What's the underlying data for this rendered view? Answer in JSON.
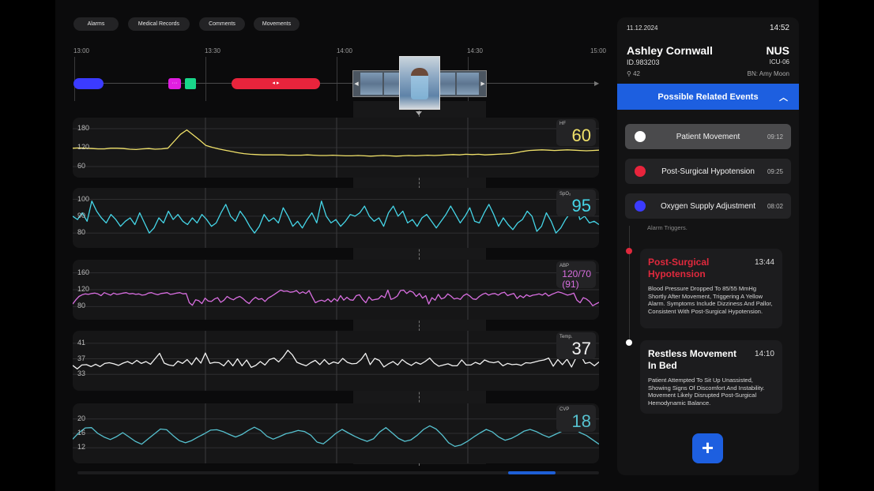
{
  "nav": {
    "tabs": [
      "Alarms",
      "Medical Records",
      "Comments",
      "Movements"
    ]
  },
  "timeline": {
    "ticks": [
      "13:00",
      "13:30",
      "14:00",
      "14:30",
      "15:00"
    ],
    "events": [
      {
        "color": "#3b3bff"
      },
      {
        "color": "#e01ee0",
        "glyph": "···"
      },
      {
        "color": "#19d68a"
      },
      {
        "color": "#e8243c",
        "glyph": "◂ ▸"
      }
    ]
  },
  "vitals": [
    {
      "name": "HF",
      "value": "60",
      "color": "#f1e26a",
      "ticks": [
        "180",
        "120",
        "60"
      ],
      "range": [
        40,
        200
      ],
      "data": [
        118,
        119,
        118,
        117,
        116,
        116,
        118,
        118,
        117,
        115,
        114,
        116,
        117,
        115,
        116,
        118,
        140,
        162,
        176,
        160,
        144,
        127,
        121,
        116,
        112,
        108,
        104,
        101,
        99,
        98,
        97,
        97,
        97,
        97,
        96,
        96,
        96,
        97,
        96,
        95,
        95,
        96,
        95,
        94,
        94,
        95,
        94,
        93,
        94,
        95,
        94,
        93,
        94,
        95,
        94,
        95,
        96,
        95,
        96,
        97,
        98,
        97,
        99,
        98,
        99,
        97,
        98,
        99,
        100,
        101,
        104,
        108,
        111,
        112,
        113,
        112,
        111,
        112,
        113,
        112,
        111,
        110,
        111,
        112
      ]
    },
    {
      "name": "SpO₂",
      "value": "95",
      "color": "#45d6e8",
      "ticks": [
        "100",
        "90",
        "80"
      ],
      "range": [
        74,
        104
      ],
      "data": [
        90,
        88,
        92,
        87,
        99,
        93,
        89,
        86,
        91,
        88,
        84,
        87,
        89,
        85,
        92,
        86,
        80,
        83,
        89,
        86,
        93,
        88,
        91,
        87,
        85,
        89,
        86,
        91,
        88,
        84,
        86,
        92,
        97,
        90,
        87,
        93,
        89,
        84,
        80,
        84,
        91,
        87,
        89,
        86,
        95,
        90,
        84,
        87,
        83,
        88,
        92,
        86,
        99,
        90,
        86,
        88,
        84,
        87,
        91,
        90,
        92,
        96,
        90,
        87,
        89,
        84,
        92,
        96,
        90,
        93,
        86,
        88,
        84,
        89,
        91,
        87,
        83,
        87,
        91,
        96,
        91,
        86,
        90,
        95,
        87,
        86,
        92,
        97,
        91,
        84,
        89,
        85,
        82,
        86,
        88,
        93,
        90,
        81,
        84,
        92,
        87,
        80,
        83,
        88,
        92,
        99,
        88,
        90,
        86,
        87,
        85
      ]
    },
    {
      "name": "ABP",
      "value": "120/70",
      "value2": "(91)",
      "color": "#d86ee0",
      "ticks": [
        "160",
        "120",
        "80"
      ],
      "range": [
        60,
        180
      ],
      "data": [
        86,
        96,
        104,
        108,
        110,
        109,
        111,
        112,
        110,
        106,
        113,
        110,
        107,
        112,
        109,
        110,
        112,
        113,
        110,
        111,
        109,
        110,
        107,
        108,
        112,
        113,
        110,
        108,
        111,
        112,
        113,
        109,
        110,
        112,
        113,
        110,
        111,
        89,
        83,
        96,
        94,
        87,
        100,
        93,
        92,
        98,
        101,
        90,
        95,
        104,
        99,
        96,
        101,
        104,
        99,
        92,
        87,
        96,
        102,
        97,
        99,
        92,
        100,
        104,
        109,
        114,
        119,
        116,
        117,
        114,
        115,
        118,
        111,
        115,
        111,
        118,
        103,
        89,
        93,
        95,
        92,
        98,
        91,
        99,
        93,
        106,
        95,
        102,
        96,
        95,
        106,
        108,
        97,
        89,
        103,
        95,
        97,
        98,
        106,
        101,
        119,
        97,
        100,
        105,
        118,
        119,
        111,
        117,
        114,
        104,
        111,
        100,
        106,
        86,
        101,
        95,
        109,
        98,
        101,
        110,
        105,
        98,
        100,
        97,
        106,
        110,
        105,
        98,
        97,
        104,
        109,
        112,
        107,
        110,
        111,
        107,
        112,
        114,
        106,
        109,
        111,
        99,
        106,
        101,
        108,
        104,
        107,
        108,
        110,
        107,
        112,
        105,
        109,
        112,
        115,
        113,
        110,
        107,
        109,
        112,
        95,
        89,
        101,
        98,
        92,
        82,
        86,
        90
      ]
    },
    {
      "name": "Temp.",
      "value": "37",
      "color": "#f2f2f2",
      "ticks": [
        "41",
        "37",
        "33"
      ],
      "range": [
        30,
        43
      ],
      "data": [
        35.3,
        34.4,
        35.4,
        35.5,
        35.0,
        35.6,
        35.0,
        35.8,
        36.0,
        35.7,
        35.3,
        35.9,
        36.3,
        35.7,
        36.6,
        35.8,
        36.3,
        35.6,
        37.0,
        38.4,
        35.9,
        35.4,
        35.2,
        36.4,
        35.8,
        36.8,
        35.5,
        37.3,
        35.9,
        38.5,
        35.8,
        36.1,
        36.0,
        35.2,
        36.6,
        35.2,
        37.0,
        35.2,
        36.7,
        34.8,
        35.3,
        36.3,
        35.4,
        36.8,
        37.2,
        36.2,
        37.5,
        39.2,
        38.0,
        36.1,
        35.6,
        35.2,
        36.0,
        36.6,
        35.5,
        36.8,
        35.6,
        36.2,
        35.8,
        37.1,
        36.1,
        35.7,
        35.8,
        36.8,
        38.4,
        35.5,
        37.1,
        36.6,
        34.9,
        35.7,
        36.3,
        35.4,
        36.8,
        35.9,
        35.3,
        36.1,
        35.6,
        36.3,
        37.2,
        35.9,
        35.1,
        35.4,
        35.7,
        35.2,
        35.2,
        36.7,
        35.4,
        35.4,
        36.1,
        35.6,
        36.7,
        36.2,
        36.0,
        36.3,
        35.2,
        35.8,
        35.5,
        35.6,
        35.3,
        36.0,
        35.9,
        36.2,
        36.5,
        36.7,
        37.2,
        35.1,
        36.8,
        35.5,
        36.9,
        34.9,
        37.3,
        37.9,
        35.8,
        36.1,
        35.2,
        36.2
      ]
    },
    {
      "name": "CVP",
      "value": "18",
      "color": "#56c1cf",
      "ticks": [
        "20",
        "16",
        "12"
      ],
      "range": [
        9,
        23
      ],
      "data": [
        14.4,
        16.2,
        17.5,
        17.6,
        16.0,
        15.0,
        14.3,
        15.1,
        16.2,
        15.0,
        13.8,
        13.0,
        14.4,
        15.8,
        17.2,
        17.0,
        15.4,
        14.0,
        13.4,
        14.0,
        15.0,
        15.9,
        16.9,
        17.0,
        16.5,
        15.7,
        15.0,
        15.7,
        16.8,
        17.7,
        16.8,
        15.2,
        14.4,
        15.1,
        15.9,
        16.3,
        16.8,
        16.5,
        15.5,
        13.6,
        13.1,
        14.5,
        16.0,
        17.1,
        16.1,
        15.2,
        14.4,
        13.8,
        14.5,
        16.4,
        17.6,
        16.1,
        14.6,
        13.8,
        14.2,
        15.5,
        17.1,
        18.1,
        17.2,
        15.5,
        13.4,
        12.4,
        12.8,
        13.8,
        15.0,
        16.1,
        17.1,
        16.4,
        15.0,
        14.1,
        14.6,
        15.5,
        16.6,
        17.1,
        16.5,
        15.6,
        14.9,
        15.7,
        16.5,
        17.5,
        17.3,
        16.2,
        15.4,
        14.2,
        13.0
      ]
    }
  ],
  "patient": {
    "date": "11.12.2024",
    "time": "14:52",
    "name": "Ashley Cornwall",
    "unit": "NUS",
    "id": "ID.983203",
    "ward": "ICU-06",
    "bed": "42",
    "nurse_label": "BN:",
    "nurse": "Amy Moon"
  },
  "related": {
    "title": "Possible Related Events",
    "items": [
      {
        "label": "Patient Movement",
        "time": "09:12",
        "color": "#ffffff",
        "active": true
      },
      {
        "label": "Post-Surgical Hypotension",
        "time": "09:25",
        "color": "#e8243c",
        "active": false
      },
      {
        "label": "Oxygen Supply Adjustment",
        "time": "08:02",
        "color": "#3b3bff",
        "active": false
      }
    ]
  },
  "events": {
    "partial": "Alarm Triggers.",
    "cards": [
      {
        "title": "Post-Surgical Hypotension",
        "time": "13:44",
        "color": "#e0293d",
        "desc": "Blood Pressure Dropped To 85/55 MmHg Shortly After Movement, Triggering A Yellow Alarm. Symptoms Include Dizziness And Pallor, Consistent With Post-Surgical Hypotension."
      },
      {
        "title": "Restless Movement In Bed",
        "time": "14:10",
        "color": "#ffffff",
        "desc": "Patient Attempted To Sit Up Unassisted, Showing Signs Of Discomfort And Instability. Movement Likely Disrupted Post-Surgical Hemodynamic Balance."
      }
    ]
  },
  "add_button": "+"
}
